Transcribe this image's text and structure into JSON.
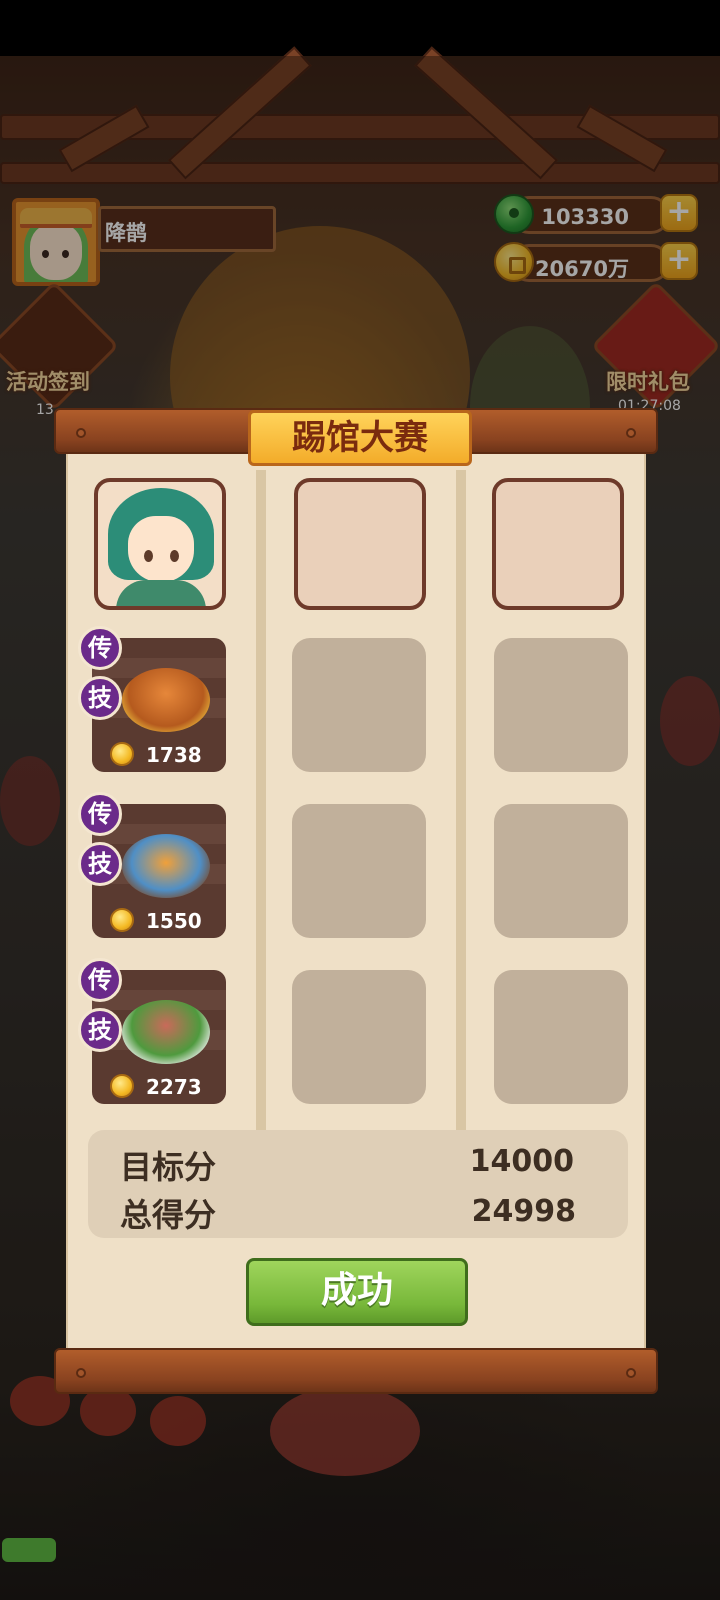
{
  "player": {
    "name": "降鹊",
    "avatar_icon": "player-avatar-portrait"
  },
  "currencies": [
    {
      "icon": "jade-icon",
      "value": "103330",
      "color": "#2e9a38"
    },
    {
      "icon": "coin-icon",
      "value": "20670万",
      "color": "#f4b923"
    }
  ],
  "side_events": {
    "left": {
      "label": "活动签到",
      "timer": "13"
    },
    "right": {
      "label": "限时礼包",
      "timer": "01:27:08"
    }
  },
  "dialog": {
    "title": "踢馆大赛",
    "player_chef_icon": "chef-portrait",
    "dishes": [
      {
        "badge_top": "传",
        "badge_bottom": "技",
        "icon": "roast-chicken-icon",
        "score": "1738"
      },
      {
        "badge_top": "传",
        "badge_bottom": "技",
        "icon": "hotpot-icon",
        "score": "1550"
      },
      {
        "badge_top": "传",
        "badge_bottom": "技",
        "icon": "meat-salad-icon",
        "score": "2273"
      }
    ],
    "target_label": "目标分",
    "target_value": "14000",
    "total_label": "总得分",
    "total_value": "24998",
    "result_button": "成功"
  },
  "colors": {
    "badge": "#6b2a8a",
    "title_board": "#f3ac2a",
    "success_button": "#78b83a",
    "panel": "#efe0c7"
  }
}
